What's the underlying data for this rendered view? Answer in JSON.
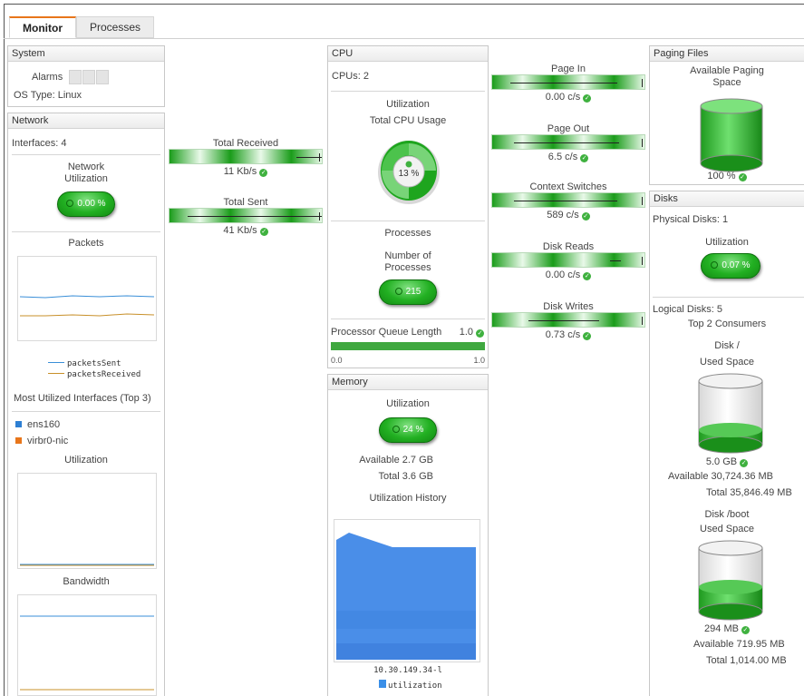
{
  "tabs": [
    {
      "label": "Monitor",
      "active": true
    },
    {
      "label": "Processes",
      "active": false
    }
  ],
  "system": {
    "title": "System",
    "alarms_label": "Alarms",
    "os_label": "OS Type: Linux"
  },
  "network": {
    "title": "Network",
    "interfaces": "Interfaces: 4",
    "utilization_label": "Network\nUtilization",
    "utilization_value": "0.00 %",
    "packets_label": "Packets",
    "legend": [
      {
        "label": "packetsSent",
        "color": "#3a8fd8"
      },
      {
        "label": "packetsReceived",
        "color": "#c8902a"
      }
    ],
    "most_utilized_title": "Most Utilized Interfaces (Top 3)",
    "interfaces_list": [
      {
        "label": "ens160",
        "color": "#2d7fd3"
      },
      {
        "label": "virbr0-nic",
        "color": "#e8761b"
      }
    ],
    "utilization_chart_label": "Utilization",
    "bandwidth_label": "Bandwidth"
  },
  "traffic": {
    "received_label": "Total Received",
    "received_value": "11 Kb/s",
    "sent_label": "Total Sent",
    "sent_value": "41 Kb/s"
  },
  "cpu": {
    "title": "CPU",
    "cpus": "CPUs: 2",
    "utilization_heading": "Utilization",
    "total_cpu_label": "Total CPU Usage",
    "total_cpu_value": "13 %",
    "processes_heading": "Processes",
    "number_label": "Number of\nProcesses",
    "number_value": "215",
    "queue_label": "Processor Queue Length",
    "queue_value": "1.0",
    "queue_fraction": 1.0,
    "queue_min": "0.0",
    "queue_max": "1.0"
  },
  "memory": {
    "title": "Memory",
    "utilization_heading": "Utilization",
    "utilization_value": "24 %",
    "available": "Available 2.7 GB",
    "total": "Total 3.6 GB",
    "history_label": "Utilization History",
    "host_label": "10.30.149.34-l",
    "legend_label": "utilization",
    "legend_color": "#3a8fe8"
  },
  "counters": [
    {
      "label": "Page In",
      "value": "0.00 c/s"
    },
    {
      "label": "Page Out",
      "value": "6.5 c/s"
    },
    {
      "label": "Context Switches",
      "value": "589 c/s"
    },
    {
      "label": "Disk Reads",
      "value": "0.00 c/s"
    },
    {
      "label": "Disk Writes",
      "value": "0.73 c/s"
    }
  ],
  "paging": {
    "title": "Paging Files",
    "label": "Available Paging\nSpace",
    "value": "100 %",
    "fill_fraction": 1.0
  },
  "disks": {
    "title": "Disks",
    "physical": "Physical Disks: 1",
    "utilization_label": "Utilization",
    "utilization_value": "0.07 %",
    "logical": "Logical Disks: 5",
    "top_consumers": "Top 2 Consumers",
    "consumers": [
      {
        "name": "Disk /",
        "used_label": "Used Space",
        "value": "5.0 GB",
        "available": "Available 30,724.36 MB",
        "total": "Total 35,846.49 MB",
        "fill_fraction": 0.14
      },
      {
        "name": "Disk /boot",
        "used_label": "Used Space",
        "value": "294 MB",
        "available": "Available 719.95 MB",
        "total": "Total 1,014.00 MB",
        "fill_fraction": 0.29
      }
    ]
  }
}
